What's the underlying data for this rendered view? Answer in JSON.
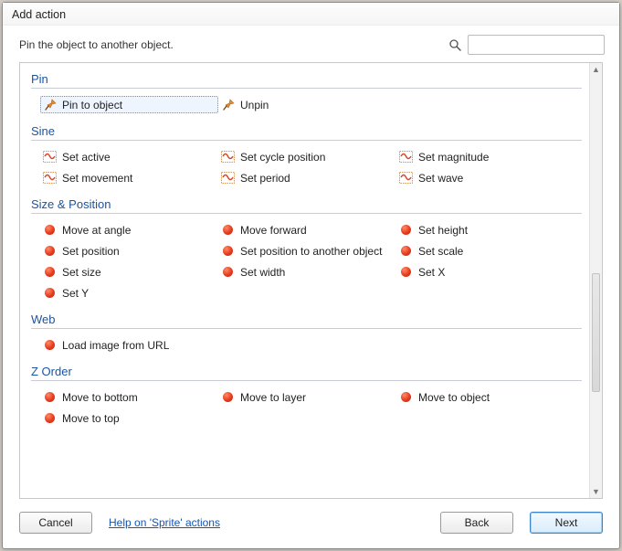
{
  "window": {
    "title": "Add action"
  },
  "description": "Pin the object to another object.",
  "search": {
    "placeholder": ""
  },
  "sections": {
    "pin": {
      "title": "Pin",
      "items": [
        "Pin to object",
        "Unpin"
      ]
    },
    "sine": {
      "title": "Sine",
      "items": [
        "Set active",
        "Set cycle position",
        "Set magnitude",
        "Set movement",
        "Set period",
        "Set wave"
      ]
    },
    "size": {
      "title": "Size & Position",
      "items": [
        "Move at angle",
        "Move forward",
        "Set height",
        "Set position",
        "Set position to another object",
        "Set scale",
        "Set size",
        "Set width",
        "Set X",
        "Set Y"
      ]
    },
    "web": {
      "title": "Web",
      "items": [
        "Load image from URL"
      ]
    },
    "zorder": {
      "title": "Z Order",
      "items": [
        "Move to bottom",
        "Move to layer",
        "Move to object",
        "Move to top"
      ]
    }
  },
  "footer": {
    "cancel": "Cancel",
    "help": "Help on 'Sprite' actions",
    "back": "Back",
    "next": "Next"
  },
  "selected_action": "Pin to object"
}
